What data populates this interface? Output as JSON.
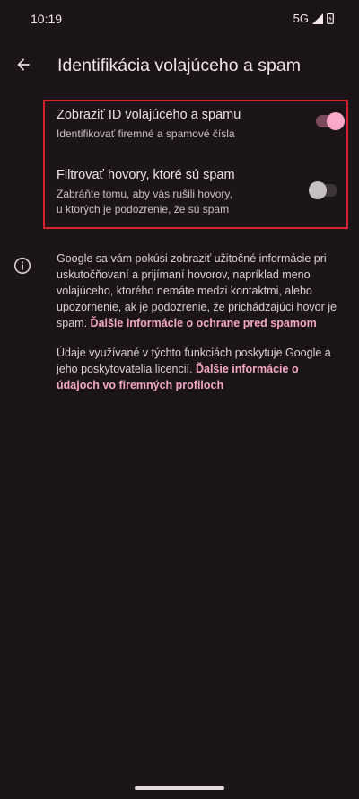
{
  "status_bar": {
    "time": "10:19",
    "network": "5G",
    "icons": [
      "signal-icon",
      "battery-icon"
    ]
  },
  "app_bar": {
    "back_icon": "arrow-back-icon",
    "title": "Identifikácia volajúceho a spam"
  },
  "settings": [
    {
      "title": "Zobraziť ID volajúceho a spamu",
      "summary": "Identifikovať firemné a spamové čísla",
      "enabled": true
    },
    {
      "title": "Filtrovať hovory, ktoré sú spam",
      "summary_line1": "Zabráňte tomu, aby vás rušili hovory,",
      "summary_line2": "u ktorých je podozrenie, že sú spam",
      "enabled": false
    }
  ],
  "info": {
    "icon": "info-icon",
    "paragraph1_text": "Google sa vám pokúsi zobraziť užitočné informácie pri uskutočňovaní a prijímaní hovorov, napríklad meno volajúceho, ktorého nemáte medzi kontaktmi, alebo upozornenie, ak je podozrenie, že prichádzajúci hovor je spam.",
    "paragraph1_link": "Ďalšie informácie o ochrane pred spamom",
    "paragraph2_text": "Údaje využívané v týchto funkciách poskytuje Google a jeho poskytovatelia licencií.",
    "paragraph2_link": "Ďalšie informácie o údajoch vo firemných profiloch"
  },
  "colors": {
    "background": "#1c1518",
    "accent": "#f4a6c4",
    "highlight_border": "#d6202b"
  }
}
